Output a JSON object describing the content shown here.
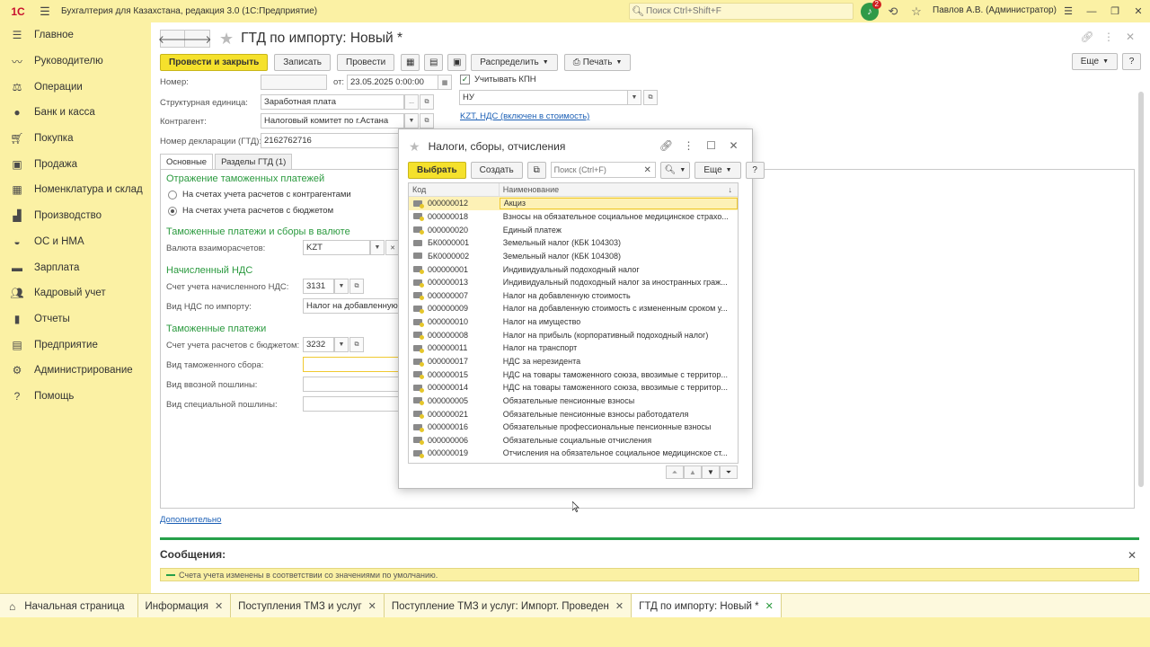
{
  "topbar": {
    "logo": "1С",
    "app_title": "Бухгалтерия для Казахстана, редакция 3.0  (1С:Предприятие)",
    "search_placeholder": "Поиск Ctrl+Shift+F",
    "notification_count": "2",
    "user": "Павлов А.В. (Администратор)"
  },
  "sidebar": {
    "items": [
      {
        "label": "Главное",
        "icon": "menu-icon"
      },
      {
        "label": "Руководителю",
        "icon": "chart-line-icon"
      },
      {
        "label": "Операции",
        "icon": "scales-icon"
      },
      {
        "label": "Банк и касса",
        "icon": "coin-icon"
      },
      {
        "label": "Покупка",
        "icon": "cart-icon"
      },
      {
        "label": "Продажа",
        "icon": "shopping-bag-icon"
      },
      {
        "label": "Номенклатура и склад",
        "icon": "warehouse-icon"
      },
      {
        "label": "Производство",
        "icon": "factory-icon"
      },
      {
        "label": "ОС и НМА",
        "icon": "car-icon"
      },
      {
        "label": "Зарплата",
        "icon": "money-icon"
      },
      {
        "label": "Кадровый учет",
        "icon": "people-icon"
      },
      {
        "label": "Отчеты",
        "icon": "bar-chart-icon"
      },
      {
        "label": "Предприятие",
        "icon": "building-icon"
      },
      {
        "label": "Администрирование",
        "icon": "gear-icon"
      },
      {
        "label": "Помощь",
        "icon": "question-icon"
      }
    ]
  },
  "form": {
    "title": "ГТД по импорту: Новый *",
    "toolbar": {
      "post_close": "Провести и закрыть",
      "save": "Записать",
      "post": "Провести",
      "distribute": "Распределить",
      "print": "Печать",
      "more": "Еще",
      "help": "?"
    },
    "fields": {
      "number_label": "Номер:",
      "number_value": "",
      "date_label": "от:",
      "date_value": "23.05.2025  0:00:00",
      "kpn_label": "Учитывать КПН",
      "kpn_checked": true,
      "struct_label": "Структурная единица:",
      "struct_value": "Заработная плата",
      "nu_value": "НУ",
      "contractor_label": "Контрагент:",
      "contractor_value": "Налоговый комитет по г.Астана",
      "vat_link": "KZT, НДС (включен в стоимость)",
      "decl_label": "Номер декларации (ГТД):",
      "decl_value": "2162762716"
    },
    "tabs": [
      "Основные",
      "Разделы ГТД (1)"
    ],
    "sections": {
      "customs_reflection": "Отражение таможенных платежей",
      "radio1": "На счетах учета расчетов с контрагентами",
      "radio2": "На счетах учета расчетов с бюджетом",
      "currency_section": "Таможенные платежи и сборы в валюте",
      "currency_label": "Валюта взаиморасчетов:",
      "currency_value": "KZT",
      "vat_section": "Начисленный НДС",
      "vat_account_label": "Счет учета начисленного НДС:",
      "vat_account_value": "3131",
      "vat_type_label": "Вид НДС по импорту:",
      "vat_type_value": "Налог на добавленную",
      "payments_section": "Таможенные платежи",
      "budget_account_label": "Счет учета расчетов с бюджетом:",
      "budget_account_value": "3232",
      "fee_type_label": "Вид таможенного сбора:",
      "import_duty_label": "Вид ввозной пошлины:",
      "special_duty_label": "Вид специальной пошлины:"
    },
    "extra_link": "Дополнительно",
    "messages_title": "Сообщения:",
    "message_text": "Счета учета изменены в соответствии со значениями по умолчанию."
  },
  "modal": {
    "title": "Налоги, сборы, отчисления",
    "select_btn": "Выбрать",
    "create_btn": "Создать",
    "search_placeholder": "Поиск (Ctrl+F)",
    "more_btn": "Еще",
    "help_btn": "?",
    "col_code": "Код",
    "col_name": "Наименование",
    "rows": [
      {
        "code": "000000012",
        "name": "Акциз"
      },
      {
        "code": "000000018",
        "name": "Взносы на обязательное социальное медицинское страхо..."
      },
      {
        "code": "000000020",
        "name": "Единый платеж"
      },
      {
        "code": "БК0000001",
        "name": "Земельный налог (КБК 104303)"
      },
      {
        "code": "БК0000002",
        "name": "Земельный налог (КБК 104308)"
      },
      {
        "code": "000000001",
        "name": "Индивидуальный подоходный налог"
      },
      {
        "code": "000000013",
        "name": "Индивидуальный подоходный налог за иностранных граж..."
      },
      {
        "code": "000000007",
        "name": "Налог на добавленную стоимость"
      },
      {
        "code": "000000009",
        "name": "Налог на добавленную стоимость с измененным сроком у..."
      },
      {
        "code": "000000010",
        "name": "Налог на имущество"
      },
      {
        "code": "000000008",
        "name": "Налог на прибыль (корпоративный подоходный налог)"
      },
      {
        "code": "000000011",
        "name": "Налог на транспорт"
      },
      {
        "code": "000000017",
        "name": "НДС за нерезидента"
      },
      {
        "code": "000000015",
        "name": "НДС на товары таможенного союза, ввозимые с территор..."
      },
      {
        "code": "000000014",
        "name": "НДС на товары таможенного союза, ввозимые с территор..."
      },
      {
        "code": "000000005",
        "name": "Обязательные пенсионные взносы"
      },
      {
        "code": "000000021",
        "name": "Обязательные пенсионные взносы работодателя"
      },
      {
        "code": "000000016",
        "name": "Обязательные профессиональные пенсионные взносы"
      },
      {
        "code": "000000006",
        "name": "Обязательные социальные отчисления"
      },
      {
        "code": "000000019",
        "name": "Отчисления на обязательное социальное медицинское ст..."
      }
    ]
  },
  "taskbar": {
    "tabs": [
      {
        "label": "Начальная страница"
      },
      {
        "label": "Информация"
      },
      {
        "label": "Поступления ТМЗ и услуг"
      },
      {
        "label": "Поступление ТМЗ и услуг: Импорт. Проведен"
      },
      {
        "label": "ГТД по импорту: Новый *"
      }
    ]
  }
}
